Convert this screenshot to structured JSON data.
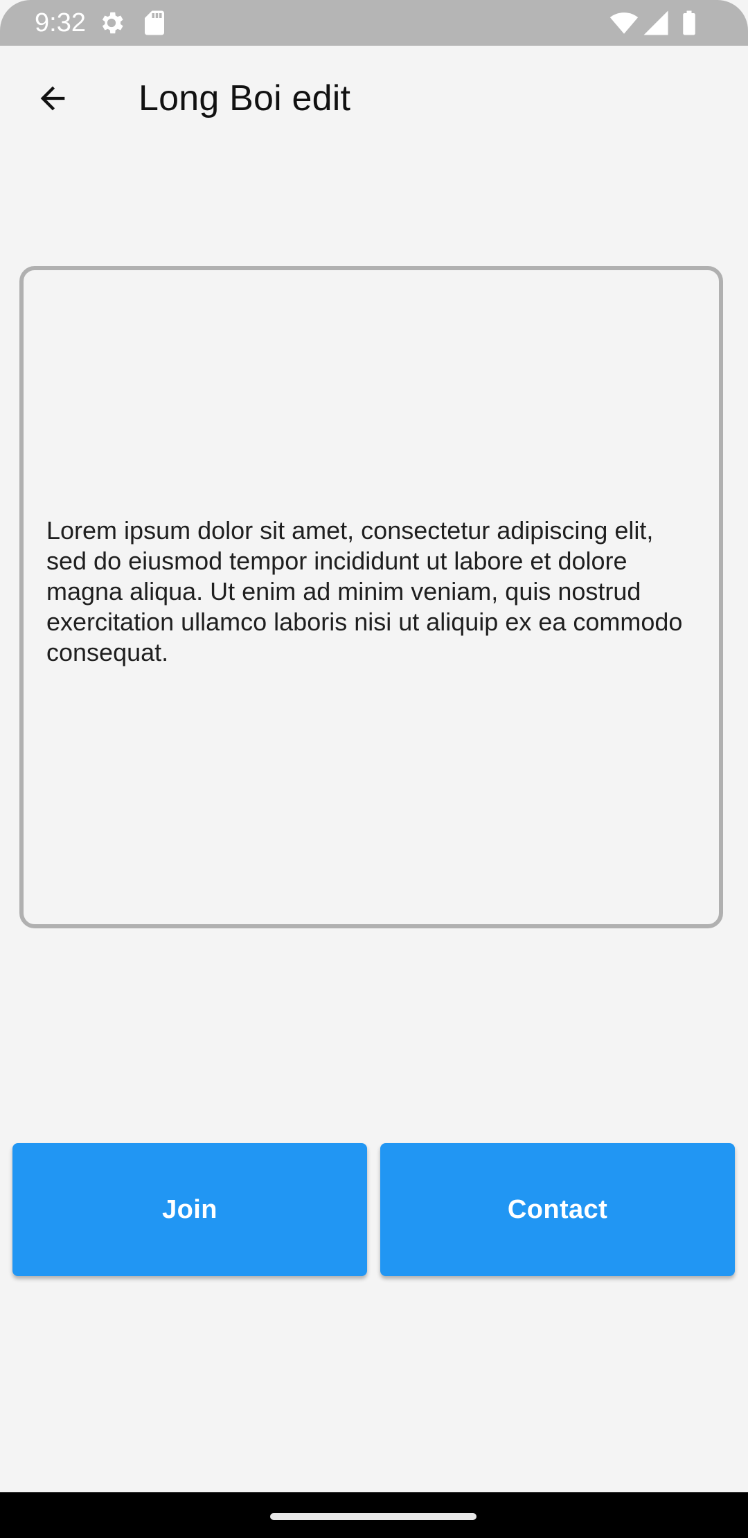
{
  "status_bar": {
    "time": "9:32",
    "left_icons": [
      "settings-gear-icon",
      "sd-card-icon"
    ],
    "right_icons": [
      "wifi-icon",
      "cell-signal-icon",
      "battery-icon"
    ]
  },
  "app_bar": {
    "back_icon": "arrow-left-icon",
    "title": "Long Boi edit"
  },
  "content": {
    "body_text": "Lorem ipsum dolor sit amet, consectetur adipiscing elit, sed do eiusmod tempor incididunt ut labore et dolore magna aliqua. Ut enim ad minim veniam, quis nostrud exercitation ullamco laboris nisi ut aliquip ex ea commodo consequat."
  },
  "actions": {
    "join_label": "Join",
    "contact_label": "Contact"
  },
  "colors": {
    "accent": "#2196f3",
    "background": "#f4f4f4",
    "status_bar": "#b5b5b5",
    "border": "#b0b0b0"
  }
}
